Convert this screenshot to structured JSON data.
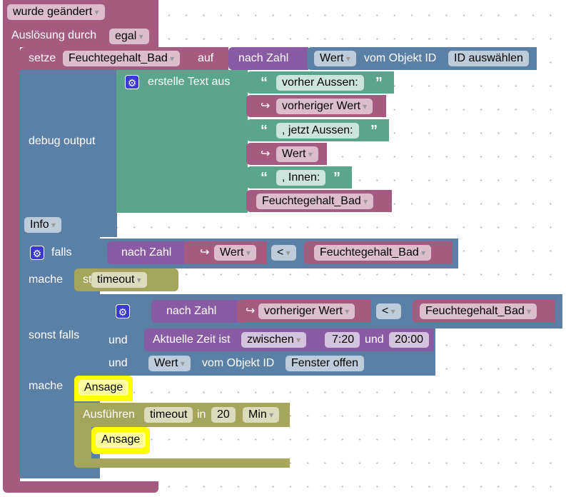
{
  "event": {
    "trigger": "wurde geändert",
    "label_ausloesung": "Auslösung durch",
    "ausloesung": "egal"
  },
  "setze": {
    "label": "setze",
    "variable": "Feuchtegehalt_Bad",
    "auf": "auf",
    "nach_zahl": "nach Zahl",
    "wert": "Wert",
    "vom_objekt": "vom Objekt ID",
    "object_id": "ID auswählen"
  },
  "debug": {
    "label": "debug output",
    "level": "Info",
    "text_join": "erstelle Text aus",
    "items": [
      {
        "kind": "text",
        "value": "vorher Aussen:"
      },
      {
        "kind": "var",
        "value": "vorheriger Wert"
      },
      {
        "kind": "text",
        "value": ", jetzt Aussen:"
      },
      {
        "kind": "var",
        "value": "Wert"
      },
      {
        "kind": "text",
        "value": ", Innen:"
      },
      {
        "kind": "var",
        "value": "Feuchtegehalt_Bad"
      }
    ],
    "quote_open": "“",
    "quote_close": "”",
    "arrow": "↪"
  },
  "if": {
    "falls": "falls",
    "nach_zahl": "nach Zahl",
    "wert": "Wert",
    "op": "<",
    "var": "Feuchtegehalt_Bad",
    "mache": "mache",
    "stop": "stop",
    "timeout": "timeout"
  },
  "elseif": {
    "label": "sonst falls",
    "nach_zahl": "nach Zahl",
    "prev": "vorheriger Wert",
    "op": "<",
    "var": "Feuchtegehalt_Bad",
    "und": "und",
    "time_label": "Aktuelle Zeit ist",
    "time_mode": "zwischen",
    "from": "7:20",
    "und2": "und",
    "to": "20:00",
    "wert": "Wert",
    "vom_objekt": "vom Objekt ID",
    "object": "Fenster offen"
  },
  "do2": {
    "mache": "mache",
    "ansage": "Ansage",
    "ausfuehren": "Ausführen",
    "timeout": "timeout",
    "in": "in",
    "amount": "20",
    "unit": "Min",
    "inner_ansage": "Ansage"
  }
}
